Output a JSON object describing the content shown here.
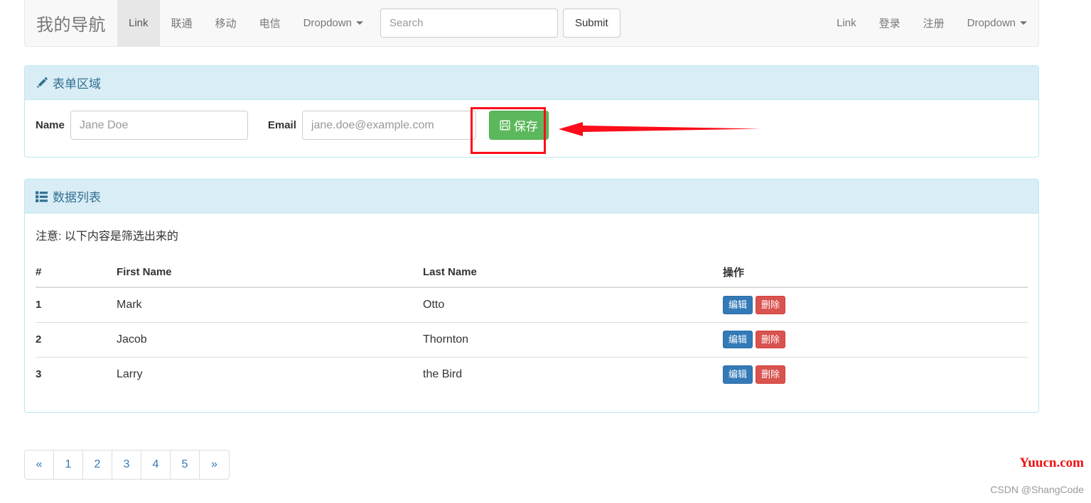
{
  "navbar": {
    "brand": "我的导航",
    "left_items": [
      {
        "label": "Link",
        "active": true,
        "caret": false
      },
      {
        "label": "联通",
        "active": false,
        "caret": false
      },
      {
        "label": "移动",
        "active": false,
        "caret": false
      },
      {
        "label": "电信",
        "active": false,
        "caret": false
      },
      {
        "label": "Dropdown",
        "active": false,
        "caret": true
      }
    ],
    "search": {
      "value": "",
      "placeholder": "Search"
    },
    "submit_label": "Submit",
    "right_items": [
      {
        "label": "Link",
        "caret": false
      },
      {
        "label": "登录",
        "caret": false
      },
      {
        "label": "注册",
        "caret": false
      },
      {
        "label": "Dropdown",
        "caret": true
      }
    ]
  },
  "form_panel": {
    "heading": "表单区域",
    "heading_icon": "pencil-icon",
    "name_label": "Name",
    "name_value": "",
    "name_placeholder": "Jane Doe",
    "email_label": "Email",
    "email_value": "",
    "email_placeholder": "jane.doe@example.com",
    "save_label": "保存",
    "save_icon": "floppy-save-icon",
    "save_color": "#5cb85c"
  },
  "annotation": {
    "box_color": "#fc0d1b",
    "arrow_color": "#fc0d1b",
    "target": "save-button"
  },
  "list_panel": {
    "heading": "数据列表",
    "heading_icon": "list-icon",
    "note": "注意: 以下内容是筛选出来的",
    "columns": [
      "#",
      "First Name",
      "Last Name",
      "操作"
    ],
    "rows": [
      {
        "idx": "1",
        "first": "Mark",
        "last": "Otto",
        "edit": "编辑",
        "delete": "删除"
      },
      {
        "idx": "2",
        "first": "Jacob",
        "last": "Thornton",
        "edit": "编辑",
        "delete": "删除"
      },
      {
        "idx": "3",
        "first": "Larry",
        "last": "the Bird",
        "edit": "编辑",
        "delete": "删除"
      }
    ],
    "edit_color": "#337ab7",
    "delete_color": "#d9534f"
  },
  "pagination": {
    "items": [
      "«",
      "1",
      "2",
      "3",
      "4",
      "5",
      "»"
    ]
  },
  "watermarks": {
    "red": "Yuucn.com",
    "gray": "CSDN @ShangCode"
  }
}
